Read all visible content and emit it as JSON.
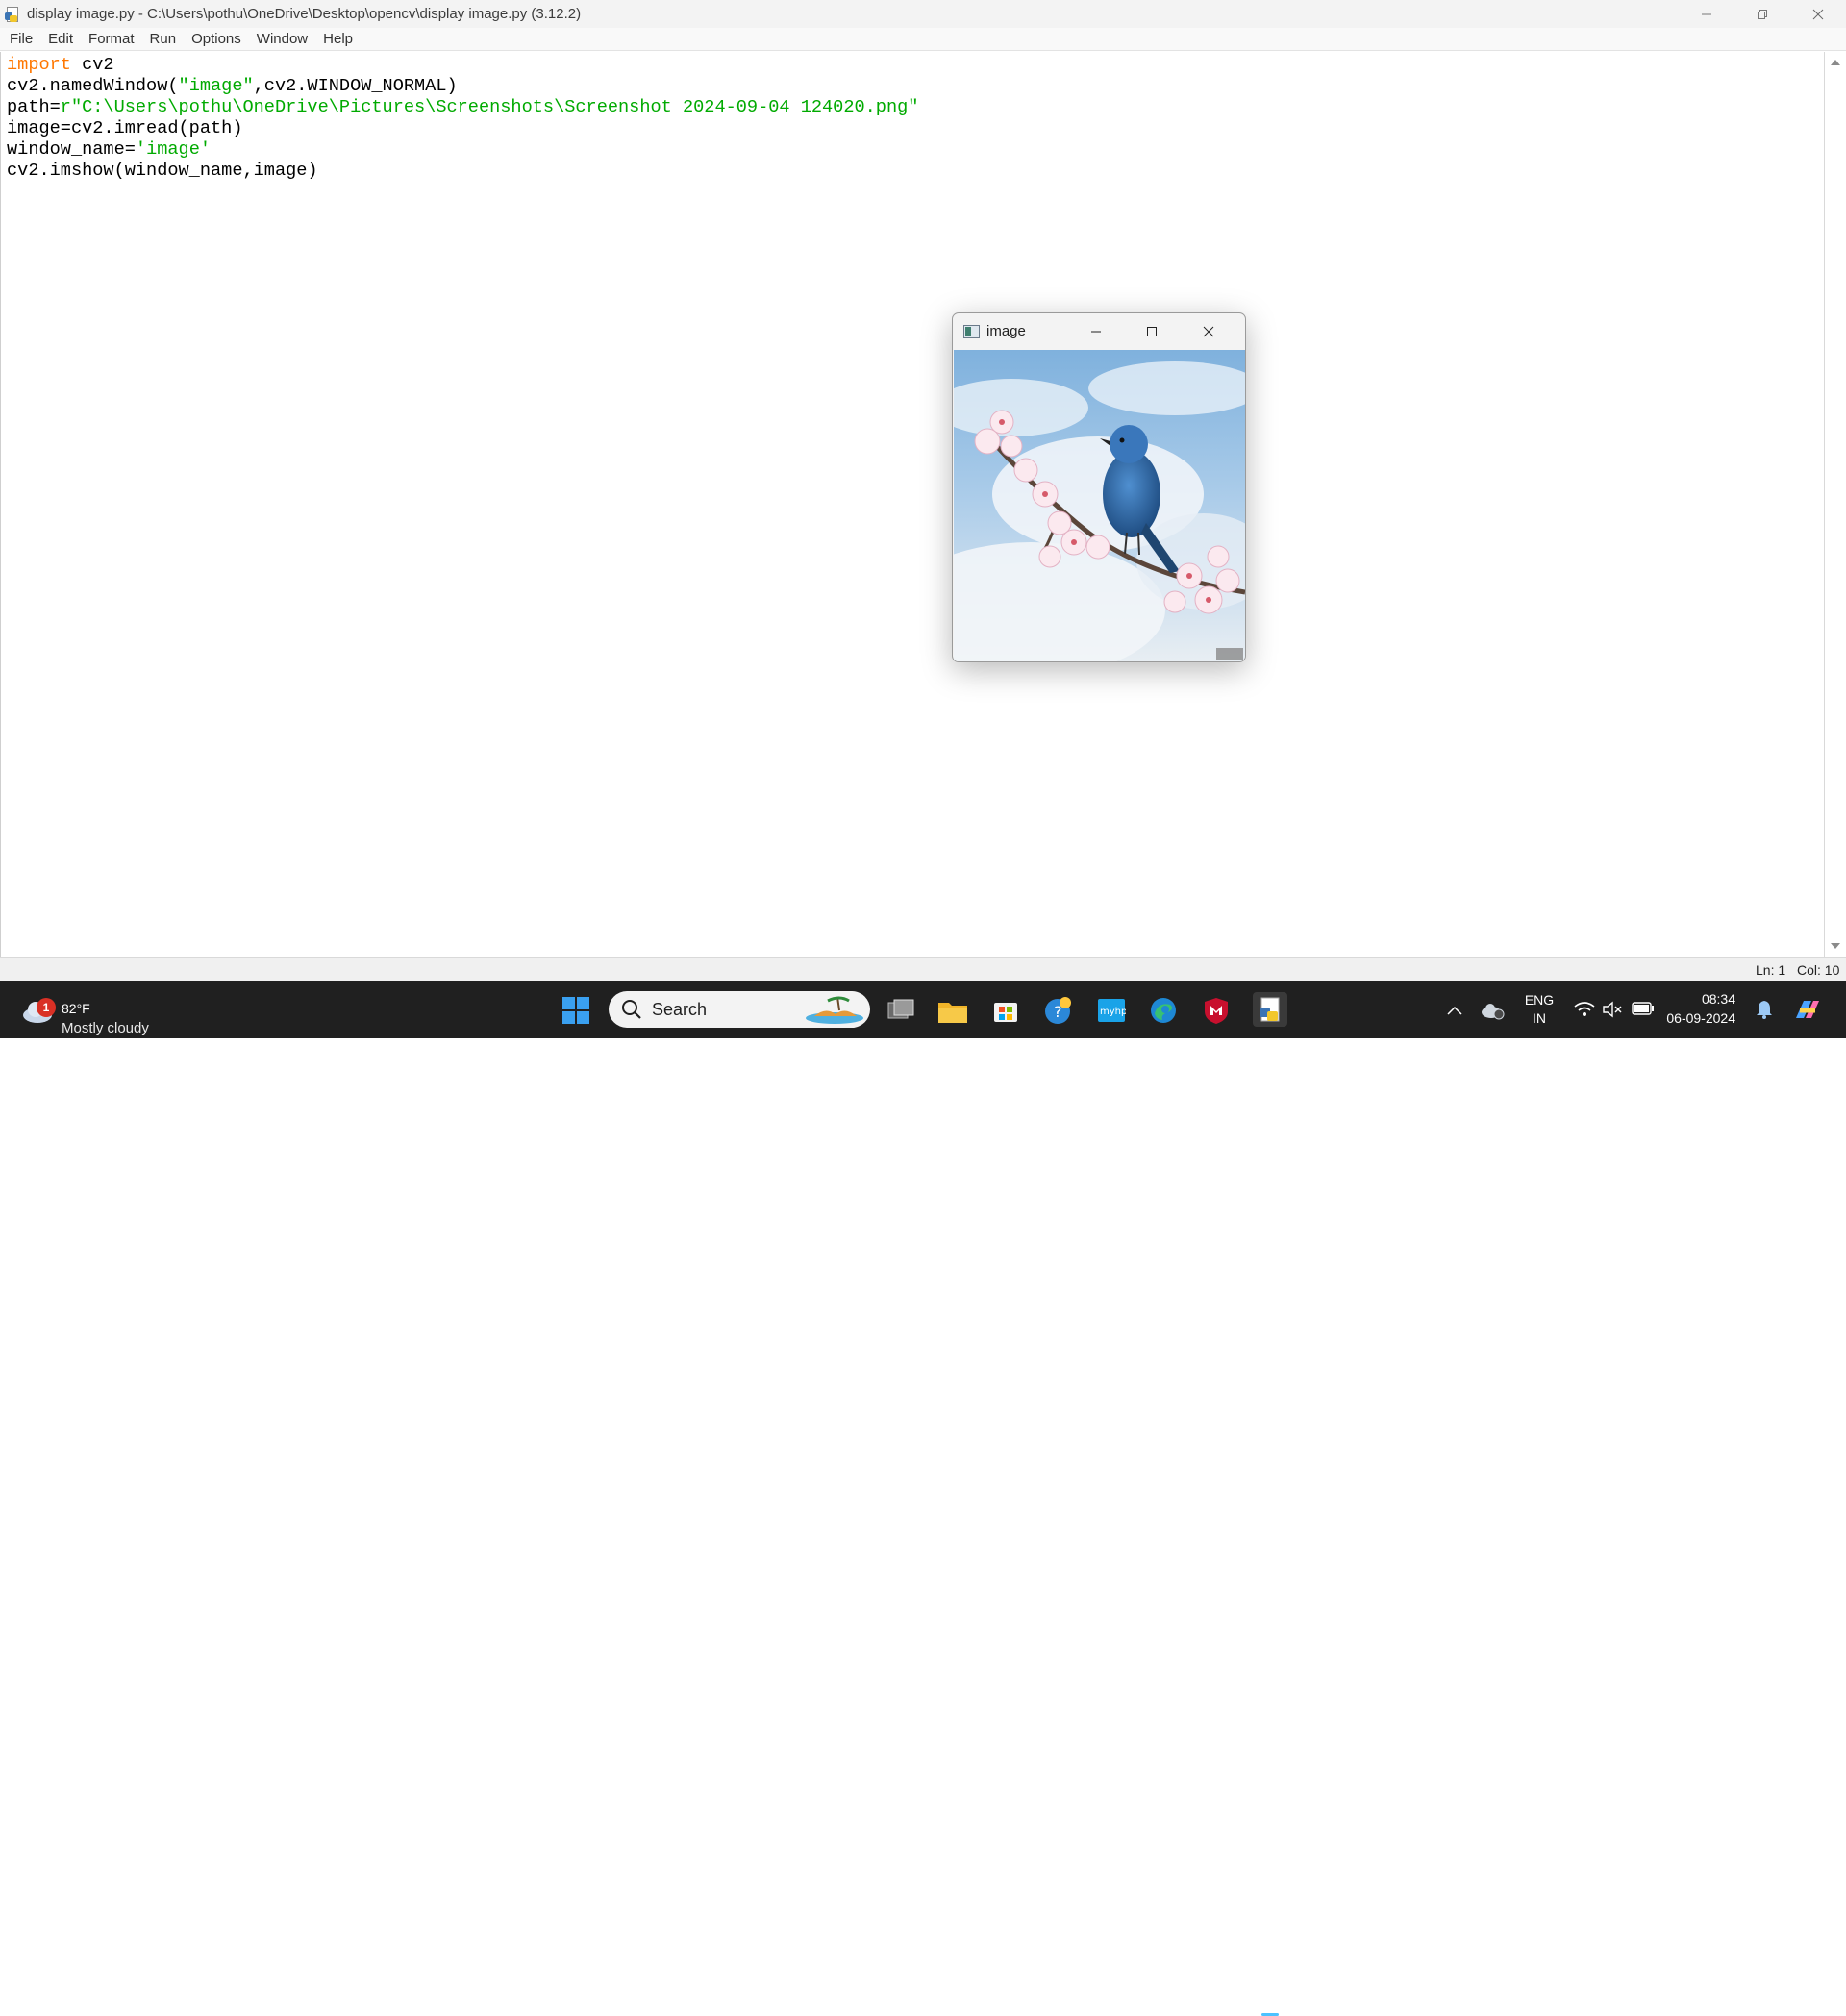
{
  "window": {
    "title": "display image.py - C:\\Users\\pothu\\OneDrive\\Desktop\\opencv\\display image.py (3.12.2)"
  },
  "menu": [
    "File",
    "Edit",
    "Format",
    "Run",
    "Options",
    "Window",
    "Help"
  ],
  "code": {
    "line1_kw": "import",
    "line1_rest": " cv2",
    "line2_a": "cv2.namedWindow(",
    "line2_str": "\"image\"",
    "line2_b": ",cv2.WINDOW_NORMAL)",
    "line3_a": "path=",
    "line3_str": "r\"C:\\Users\\pothu\\OneDrive\\Pictures\\Screenshots\\Screenshot 2024-09-04 124020.png\"",
    "line4": "image=cv2.imread(path)",
    "line5_a": "window_name=",
    "line5_str": "'image'",
    "line6": "cv2.imshow(window_name,image)"
  },
  "statusbar": {
    "line": "Ln: 1",
    "col": "Col: 10"
  },
  "image_window": {
    "title": "image"
  },
  "taskbar": {
    "weather_badge": "1",
    "temperature": "82°F",
    "condition": "Mostly cloudy",
    "search_label": "Search",
    "language_top": "ENG",
    "language_bottom": "IN",
    "time": "08:34",
    "date": "06-09-2024"
  },
  "colors": {
    "keyword": "#ff7700",
    "string": "#00aa00",
    "taskbar_bg": "#202020",
    "accent": "#4cc2ff"
  }
}
